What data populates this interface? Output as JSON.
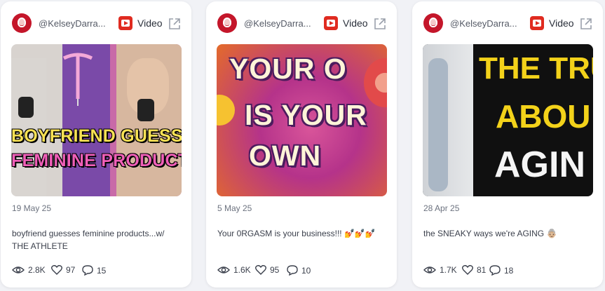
{
  "cards": [
    {
      "handle": "@KelseyDarra...",
      "type_label": "Video",
      "date": "19 May 25",
      "caption": "boyfriend guesses feminine products...w/ THE ATHLETE",
      "thumbnail_text": [
        "BOYFRIEND GUESSES",
        "FEMININE PRODUCTS"
      ],
      "views": "2.8K",
      "likes": "97",
      "comments": "15"
    },
    {
      "handle": "@KelseyDarra...",
      "type_label": "Video",
      "date": "5 May 25",
      "caption": "Your 0RGASM is your business!!! 💅💅💅",
      "thumbnail_text": [
        "YOUR O",
        "IS YOUR",
        "OWN"
      ],
      "views": "1.6K",
      "likes": "95",
      "comments": "10"
    },
    {
      "handle": "@KelseyDarra...",
      "type_label": "Video",
      "date": "28 Apr 25",
      "caption": "the SNEAKY ways we're AGING 👵🏼",
      "thumbnail_text": [
        "THE TRU",
        "ABOU",
        "AGIN"
      ],
      "views": "1.7K",
      "likes": "81",
      "comments": "18"
    }
  ],
  "icons": {
    "platform": "youtube-icon",
    "external": "external-link-icon",
    "views": "eye-icon",
    "likes": "heart-icon",
    "comments": "comment-icon"
  },
  "colors": {
    "youtube_red": "#e02b20",
    "card_bg": "#ffffff",
    "page_bg": "#f1f2f6"
  }
}
